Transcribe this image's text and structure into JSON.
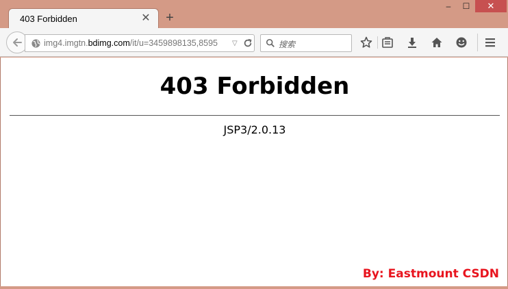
{
  "tab": {
    "title": "403 Forbidden",
    "close_glyph": "✕"
  },
  "new_tab_glyph": "+",
  "window_controls": {
    "minimize": "–",
    "maximize": "☐",
    "close": "✕"
  },
  "urlbar": {
    "prefix": "img4.imgtn.",
    "domain": "bdimg.com",
    "suffix": "/it/u=3459898135,8595"
  },
  "searchbar": {
    "placeholder": "搜索"
  },
  "toolbar_icons": [
    "star-icon",
    "reading-list-icon",
    "download-icon",
    "home-icon",
    "smiley-icon",
    "menu-icon"
  ],
  "page": {
    "heading": "403 Forbidden",
    "server": "JSP3/2.0.13"
  },
  "watermark": "By: Eastmount CSDN",
  "colors": {
    "frame": "#d49a86",
    "close_button": "#c75050",
    "watermark": "#e8141e"
  }
}
